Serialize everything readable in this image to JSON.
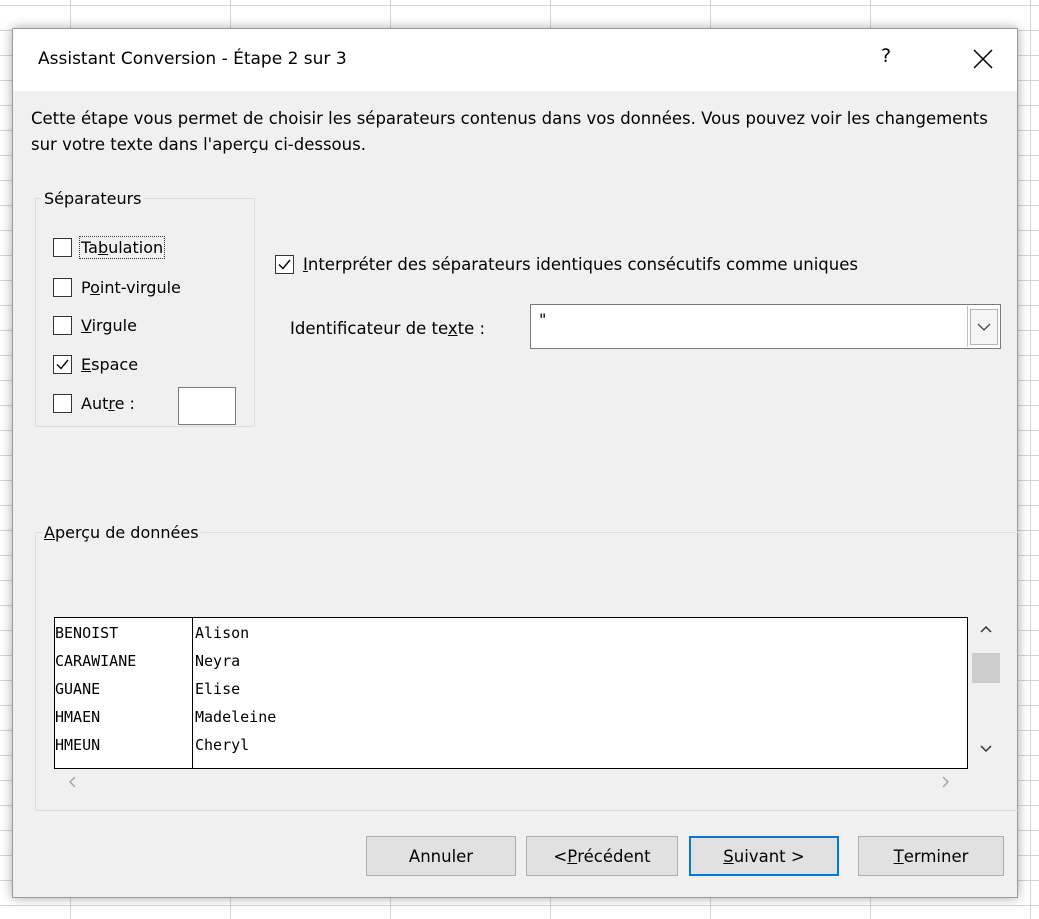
{
  "dialog": {
    "title": "Assistant Conversion - Étape 2 sur 3",
    "help_label": "?",
    "description": "Cette étape vous permet de choisir les séparateurs contenus dans vos données. Vous pouvez voir les changements sur votre texte dans l'aperçu ci-dessous."
  },
  "separators": {
    "legend": "Séparateurs",
    "items": [
      {
        "before": "Ta",
        "key": "b",
        "after": "ulation",
        "checked": false
      },
      {
        "before": "P",
        "key": "o",
        "after": "int-virgule",
        "checked": false
      },
      {
        "before": "",
        "key": "V",
        "after": "irgule",
        "checked": false
      },
      {
        "before": "",
        "key": "E",
        "after": "space",
        "checked": true
      },
      {
        "before": "Aut",
        "key": "r",
        "after": "e :",
        "checked": false
      }
    ],
    "other_value": ""
  },
  "options": {
    "consecutive": {
      "key": "I",
      "after": "nterpréter des séparateurs identiques consécutifs comme uniques",
      "checked": true
    },
    "text_qualifier": {
      "before": "Identificateur de te",
      "key": "x",
      "after": "te :",
      "value": "\""
    }
  },
  "preview": {
    "legend_key": "A",
    "legend_after": "perçu de données",
    "rows": [
      [
        "BENOIST",
        "Alison"
      ],
      [
        "CARAWIANE",
        "Neyra"
      ],
      [
        "GUANE",
        "Elise"
      ],
      [
        "HMAEN",
        "Madeleine"
      ],
      [
        "HMEUN",
        "Cheryl"
      ]
    ]
  },
  "buttons": {
    "cancel": "Annuler",
    "previous_before": "< ",
    "previous_key": "P",
    "previous_after": "récédent",
    "next_key": "S",
    "next_after": "uivant >",
    "finish_key": "T",
    "finish_after": "erminer"
  }
}
